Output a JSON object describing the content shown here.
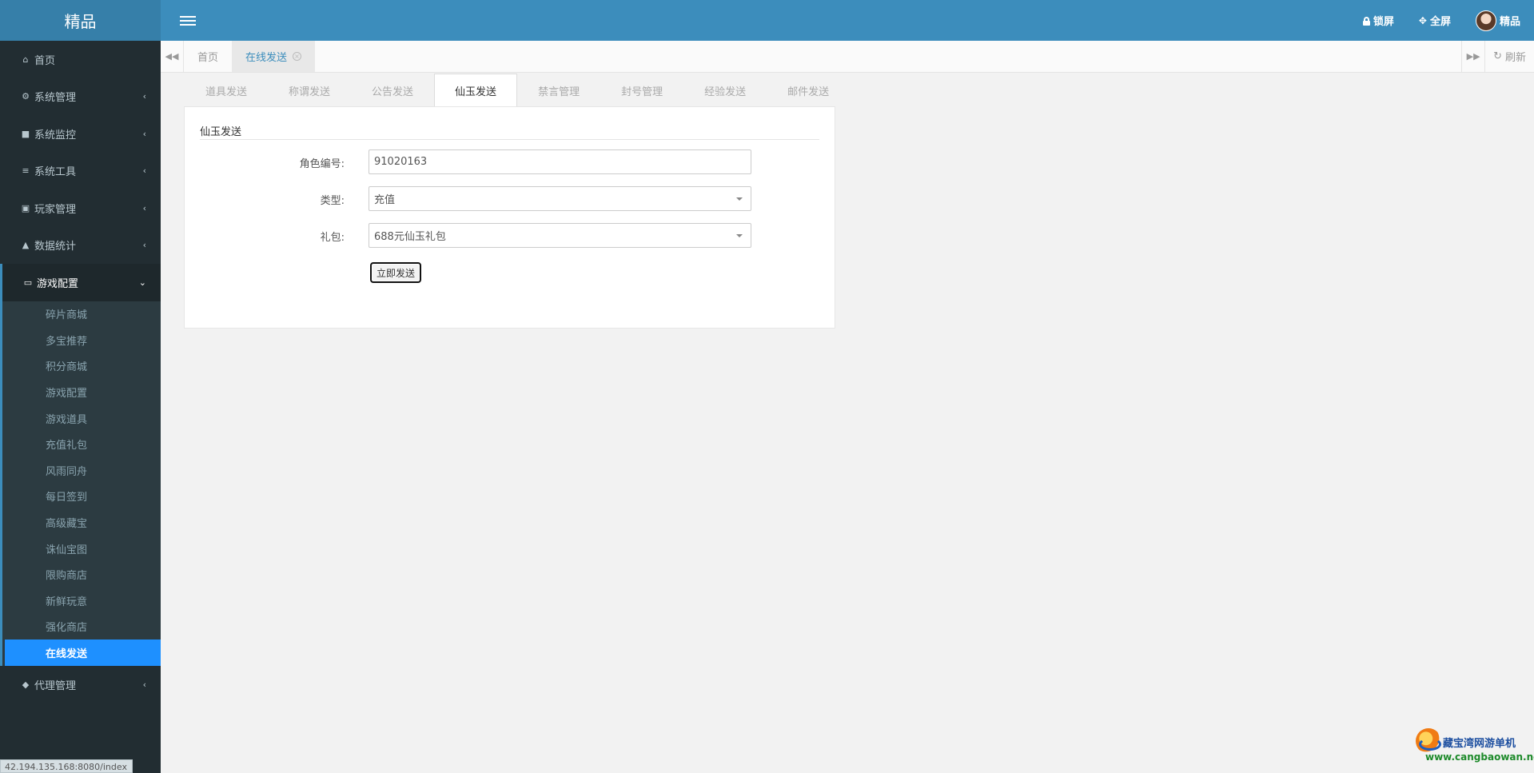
{
  "header": {
    "logo": "精品",
    "lock_label": "锁屏",
    "fullscreen_label": "全屏",
    "user_name": "精品"
  },
  "sidebar": {
    "items_top": [
      {
        "label": "首页",
        "icon": "home-icon",
        "caret": false
      },
      {
        "label": "系统管理",
        "icon": "gear-icon",
        "caret": true
      },
      {
        "label": "系统监控",
        "icon": "video-camera-icon",
        "caret": true
      },
      {
        "label": "系统工具",
        "icon": "bars-icon",
        "caret": true
      },
      {
        "label": "玩家管理",
        "icon": "id-card-icon",
        "caret": true
      },
      {
        "label": "数据统计",
        "icon": "area-chart-icon",
        "caret": true
      }
    ],
    "group": {
      "label": "游戏配置",
      "icon": "desktop-icon",
      "children": [
        "碎片商城",
        "多宝推荐",
        "积分商城",
        "游戏配置",
        "游戏道具",
        "充值礼包",
        "风雨同舟",
        "每日签到",
        "高级藏宝",
        "诛仙宝图",
        "限购商店",
        "新鲜玩意",
        "强化商店",
        "在线发送"
      ],
      "active_child": "在线发送"
    },
    "items_bottom": [
      {
        "label": "代理管理",
        "icon": "users-icon",
        "caret": true
      }
    ],
    "status_url": "42.194.135.168:8080/index"
  },
  "tabbar": {
    "tabs": [
      {
        "label": "首页",
        "active": false
      },
      {
        "label": "在线发送",
        "active": true
      }
    ],
    "refresh_label": "刷新"
  },
  "subtabs": [
    "道具发送",
    "称谓发送",
    "公告发送",
    "仙玉发送",
    "禁言管理",
    "封号管理",
    "经验发送",
    "邮件发送"
  ],
  "active_subtab": "仙玉发送",
  "form": {
    "legend": "仙玉发送",
    "role_label": "角色编号:",
    "role_value": "91020163",
    "type_label": "类型:",
    "type_value": "充值",
    "gift_label": "礼包:",
    "gift_value": "688元仙玉礼包",
    "submit_label": "立即发送"
  },
  "watermark": {
    "title": "藏宝湾网游单机",
    "url": "www.cangbaowan.net"
  },
  "colors": {
    "header": "#3c8dbc",
    "sidebar": "#222d32",
    "active_item": "#1e90ff"
  }
}
